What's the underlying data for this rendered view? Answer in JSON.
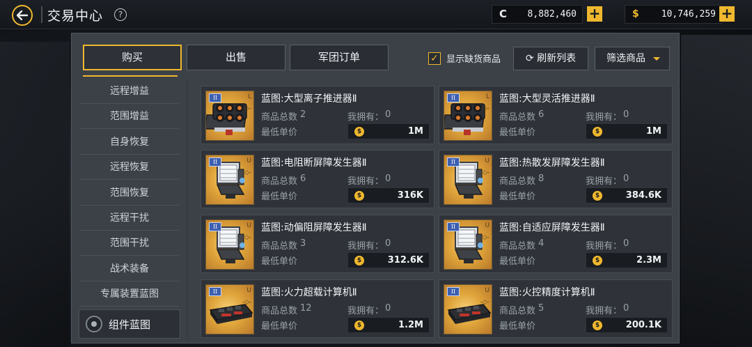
{
  "header": {
    "title": "交易中心",
    "help": "?",
    "currency_c": {
      "symbol": "C",
      "value": "8,882,460"
    },
    "currency_s": {
      "symbol": "$",
      "value": "10,746,259"
    },
    "plus": "+"
  },
  "tabs": [
    {
      "label": "购买",
      "active": true
    },
    {
      "label": "出售",
      "active": false
    },
    {
      "label": "军团订单",
      "active": false
    }
  ],
  "controls": {
    "show_out_of_stock": {
      "label": "显示缺货商品",
      "checked": true
    },
    "refresh_label": "刷新列表",
    "filter_label": "筛选商品"
  },
  "sidebar": {
    "items": [
      {
        "label": "远程增益"
      },
      {
        "label": "范围增益"
      },
      {
        "label": "自身恢复"
      },
      {
        "label": "远程恢复"
      },
      {
        "label": "范围恢复"
      },
      {
        "label": "远程干扰"
      },
      {
        "label": "范围干扰"
      },
      {
        "label": "战术装备"
      },
      {
        "label": "专属装置蓝图"
      }
    ],
    "active": {
      "label": "组件蓝图"
    }
  },
  "labels": {
    "total": "商品总数",
    "owned": "我拥有：",
    "min_price": "最低单价",
    "coin": "$"
  },
  "items": [
    {
      "name": "蓝图:大型离子推进器Ⅱ",
      "tier": "II",
      "grade": "L",
      "total": "2",
      "owned": "0",
      "price": "1M",
      "kind": "thruster"
    },
    {
      "name": "蓝图:大型灵活推进器Ⅱ",
      "tier": "II",
      "grade": "L",
      "total": "6",
      "owned": "0",
      "price": "1M",
      "kind": "thruster"
    },
    {
      "name": "蓝图:电阻断屏障发生器Ⅱ",
      "tier": "II",
      "grade": "U",
      "total": "6",
      "owned": "0",
      "price": "316K",
      "kind": "shield"
    },
    {
      "name": "蓝图:热散发屏障发生器Ⅱ",
      "tier": "II",
      "grade": "U",
      "total": "8",
      "owned": "0",
      "price": "384.6K",
      "kind": "shield"
    },
    {
      "name": "蓝图:动偏阻屏障发生器Ⅱ",
      "tier": "II",
      "grade": "U",
      "total": "3",
      "owned": "0",
      "price": "312.6K",
      "kind": "shield"
    },
    {
      "name": "蓝图:自适应屏障发生器Ⅱ",
      "tier": "II",
      "grade": "U",
      "total": "4",
      "owned": "0",
      "price": "2.3M",
      "kind": "shield"
    },
    {
      "name": "蓝图:火力超载计算机Ⅱ",
      "tier": "II",
      "grade": "U",
      "total": "12",
      "owned": "0",
      "price": "1.2M",
      "kind": "computer"
    },
    {
      "name": "蓝图:火控精度计算机Ⅱ",
      "tier": "II",
      "grade": "U",
      "total": "5",
      "owned": "0",
      "price": "200.1K",
      "kind": "computer"
    }
  ]
}
